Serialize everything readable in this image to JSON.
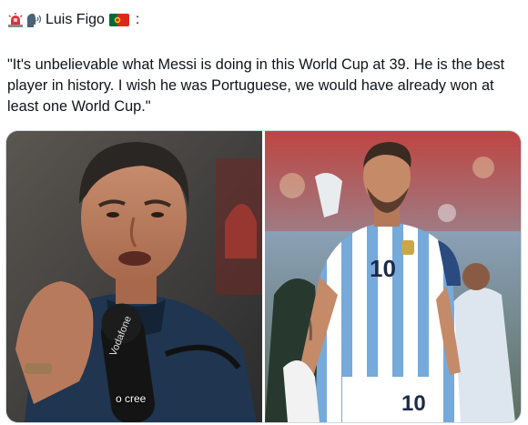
{
  "post": {
    "author_name": "Luis Figo",
    "separator": ":",
    "text": "\"It's unbelievable what Messi is doing in this World Cup at 39. He is the best player in history. I wish he was Portuguese, we would have already won at least one World Cup.\"",
    "emojis": [
      "rotating-light-icon",
      "speaking-head-icon",
      "portugal-flag-icon"
    ]
  },
  "media": {
    "left_photo": {
      "subject": "figo-interview-photo",
      "mic_brand": "Vodafone",
      "caption": "o cree"
    },
    "right_photo": {
      "subject": "messi-argentina-kit-photo",
      "jersey_number": "10",
      "shorts_number": "10"
    }
  },
  "colors": {
    "text": "#0f1419",
    "border": "#cfd9de",
    "argentina_blue": "#75aadb",
    "portugal_green": "#046a38",
    "portugal_red": "#da291c"
  }
}
